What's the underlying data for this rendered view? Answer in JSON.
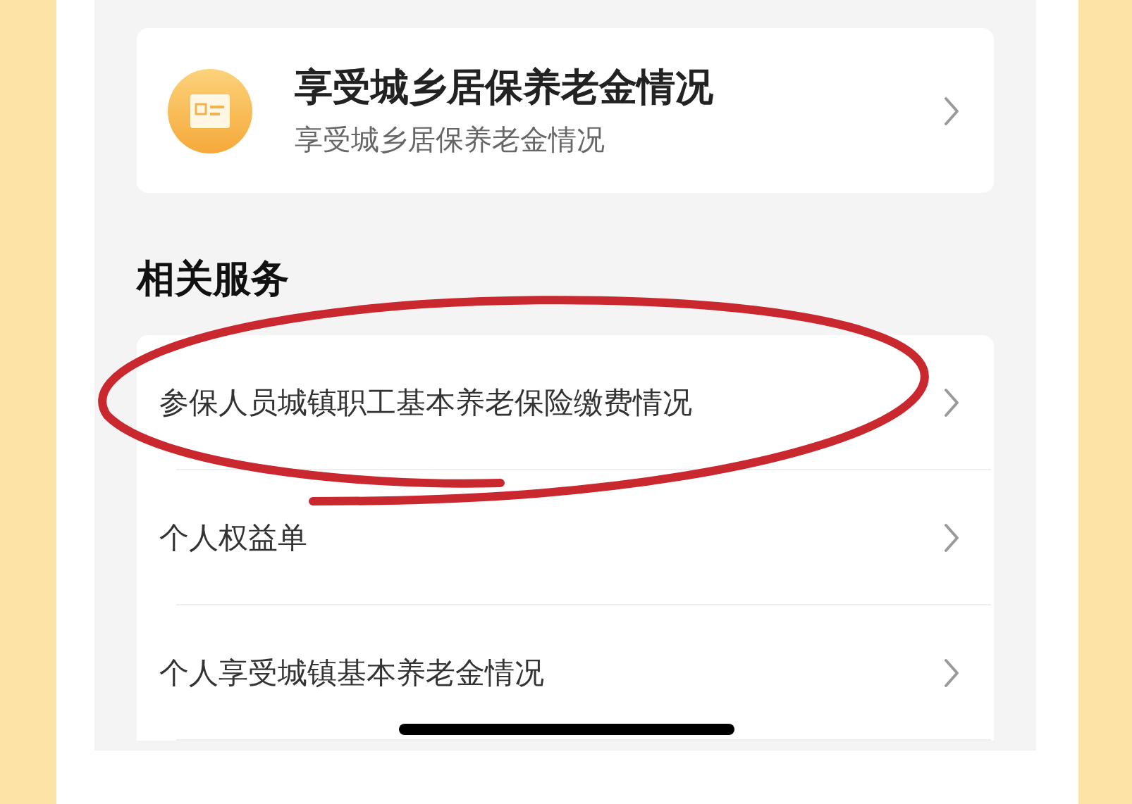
{
  "top_card": {
    "title": "享受城乡居保养老金情况",
    "subtitle": "享受城乡居保养老金情况"
  },
  "section_title": "相关服务",
  "services": [
    {
      "label": "参保人员城镇职工基本养老保险缴费情况",
      "circled": true
    },
    {
      "label": "个人权益单",
      "circled": false
    },
    {
      "label": "个人享受城镇基本养老金情况",
      "circled": false
    }
  ]
}
